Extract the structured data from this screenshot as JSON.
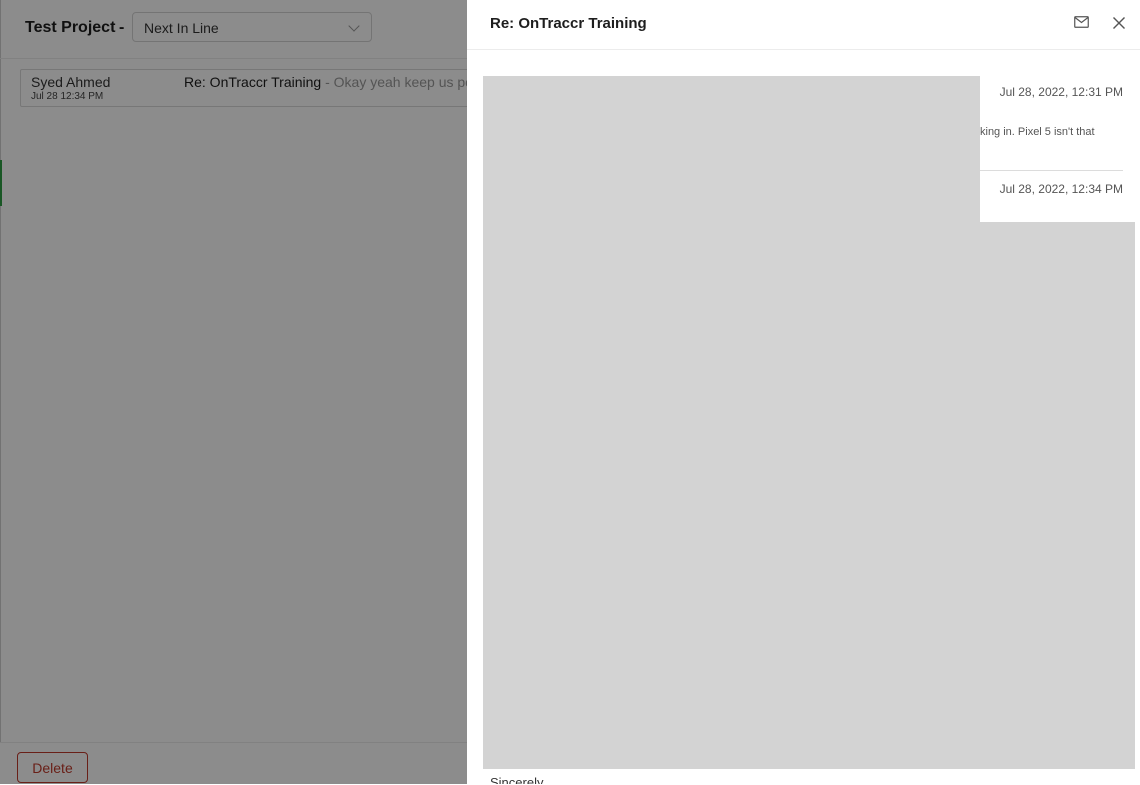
{
  "project": {
    "title": "Test Project",
    "separator": "-"
  },
  "status_select": {
    "value": "Next In Line"
  },
  "email_list": [
    {
      "sender": "Syed Ahmed",
      "date": "Jul 28 12:34 PM",
      "subject": "Re: OnTraccr Training",
      "separator": " - ",
      "preview": "Okay yeah keep us po"
    }
  ],
  "footer": {
    "delete_label": "Delete"
  },
  "drawer": {
    "title": "Re: OnTraccr Training",
    "icons": [
      "mail-icon",
      "close-icon"
    ],
    "messages": [
      {
        "timestamp": "Jul 28, 2022, 12:31 PM",
        "body_fragment": "king in. Pixel 5 isn't that"
      },
      {
        "timestamp": "Jul 28, 2022, 12:34 PM"
      }
    ],
    "signoff": "Sincerely,"
  },
  "colors": {
    "danger": "#c0392b",
    "redaction": "#d3d3d3",
    "overlay": "rgba(0,0,0,0.45)"
  }
}
